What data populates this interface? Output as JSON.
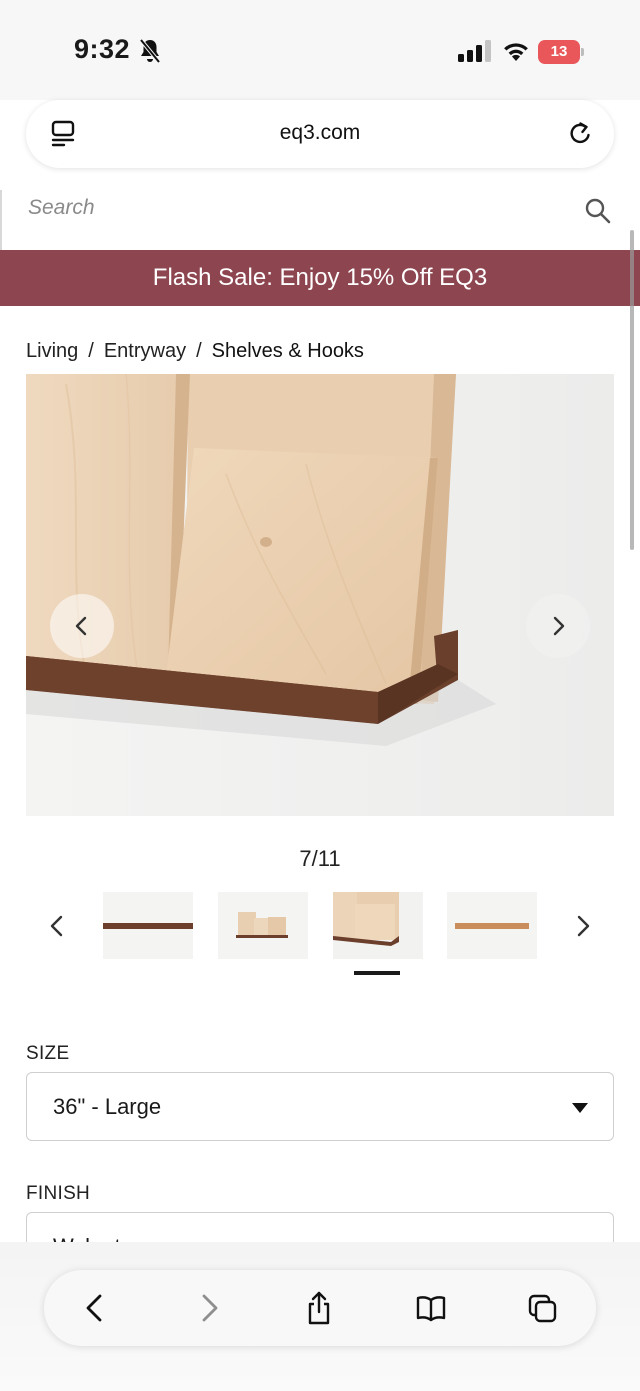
{
  "status_bar": {
    "time": "9:32",
    "battery_level": "13"
  },
  "browser": {
    "url": "eq3.com"
  },
  "site": {
    "search_placeholder": "Search",
    "promo_banner": "Flash Sale: Enjoy 15% Off EQ3",
    "breadcrumb": [
      {
        "label": "Living"
      },
      {
        "label": "Entryway"
      },
      {
        "label": "Shelves & Hooks"
      }
    ],
    "breadcrumb_separator": "/"
  },
  "gallery": {
    "counter": "7/11",
    "current_index": 7,
    "total": 11,
    "thumbnails": [
      {
        "name": "walnut shelf front"
      },
      {
        "name": "shelf with boards small"
      },
      {
        "name": "shelf with boards selected"
      },
      {
        "name": "oak shelf front"
      }
    ]
  },
  "options": {
    "size": {
      "label": "SIZE",
      "selected": "36\" - Large"
    },
    "finish": {
      "label": "FINISH",
      "selected": "Walnut"
    }
  },
  "colors": {
    "promo_bg": "#8d4650",
    "walnut": "#6b3f2c",
    "maple": "#e8cfb2"
  },
  "icons": {
    "status": [
      "bell-slash-icon",
      "cellular-signal-icon",
      "wifi-icon",
      "battery-icon"
    ],
    "address_bar": [
      "tabs-overview-icon",
      "reload-icon"
    ],
    "toolbar": [
      "back-icon",
      "forward-icon",
      "share-icon",
      "bookmarks-icon",
      "tabs-icon"
    ]
  }
}
